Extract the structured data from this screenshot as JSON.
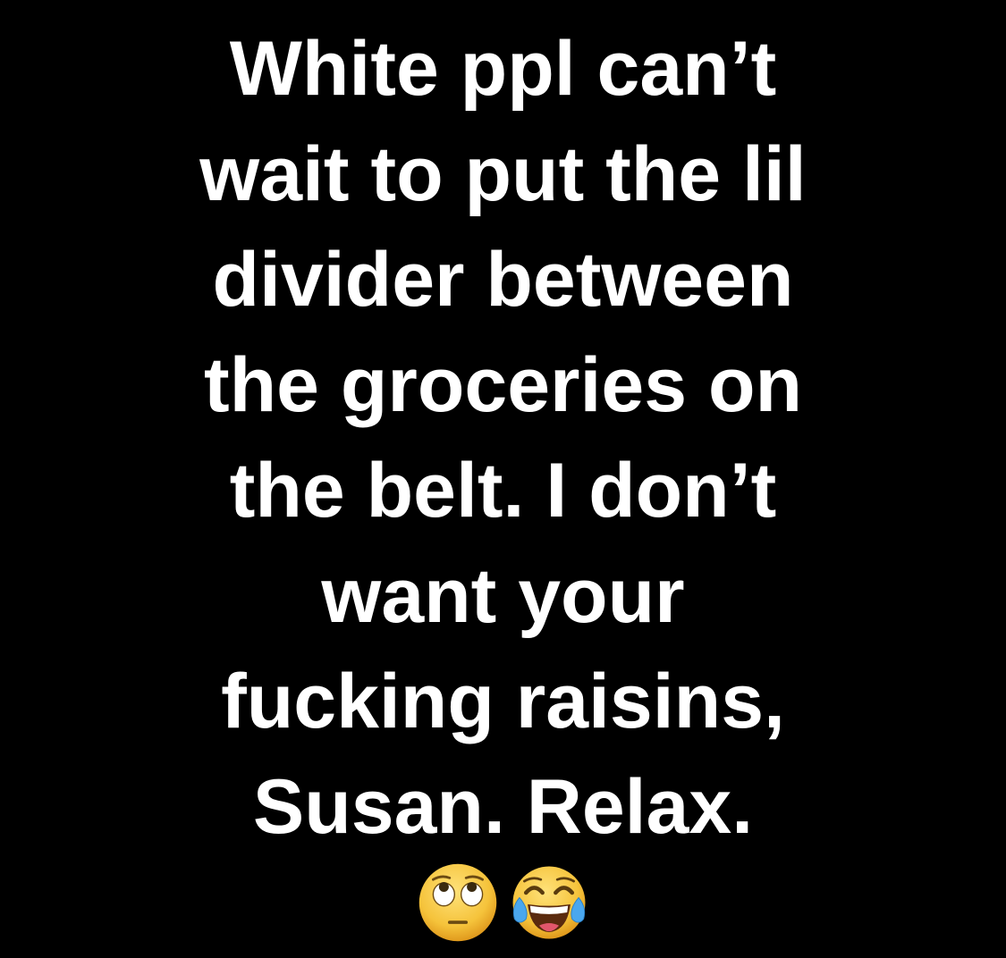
{
  "text": {
    "lines": [
      "White ppl can’t",
      "wait to put the lil",
      "divider between",
      "the groceries on",
      "the belt. I don’t",
      "want your",
      "fucking raisins,",
      "Susan. Relax."
    ]
  },
  "emojis": [
    {
      "icon": "eye-roll-emoji-icon"
    },
    {
      "icon": "tears-of-joy-emoji-icon"
    }
  ],
  "colors": {
    "background": "#000000",
    "text": "#ffffff",
    "emoji_face": "#f5c33b"
  }
}
